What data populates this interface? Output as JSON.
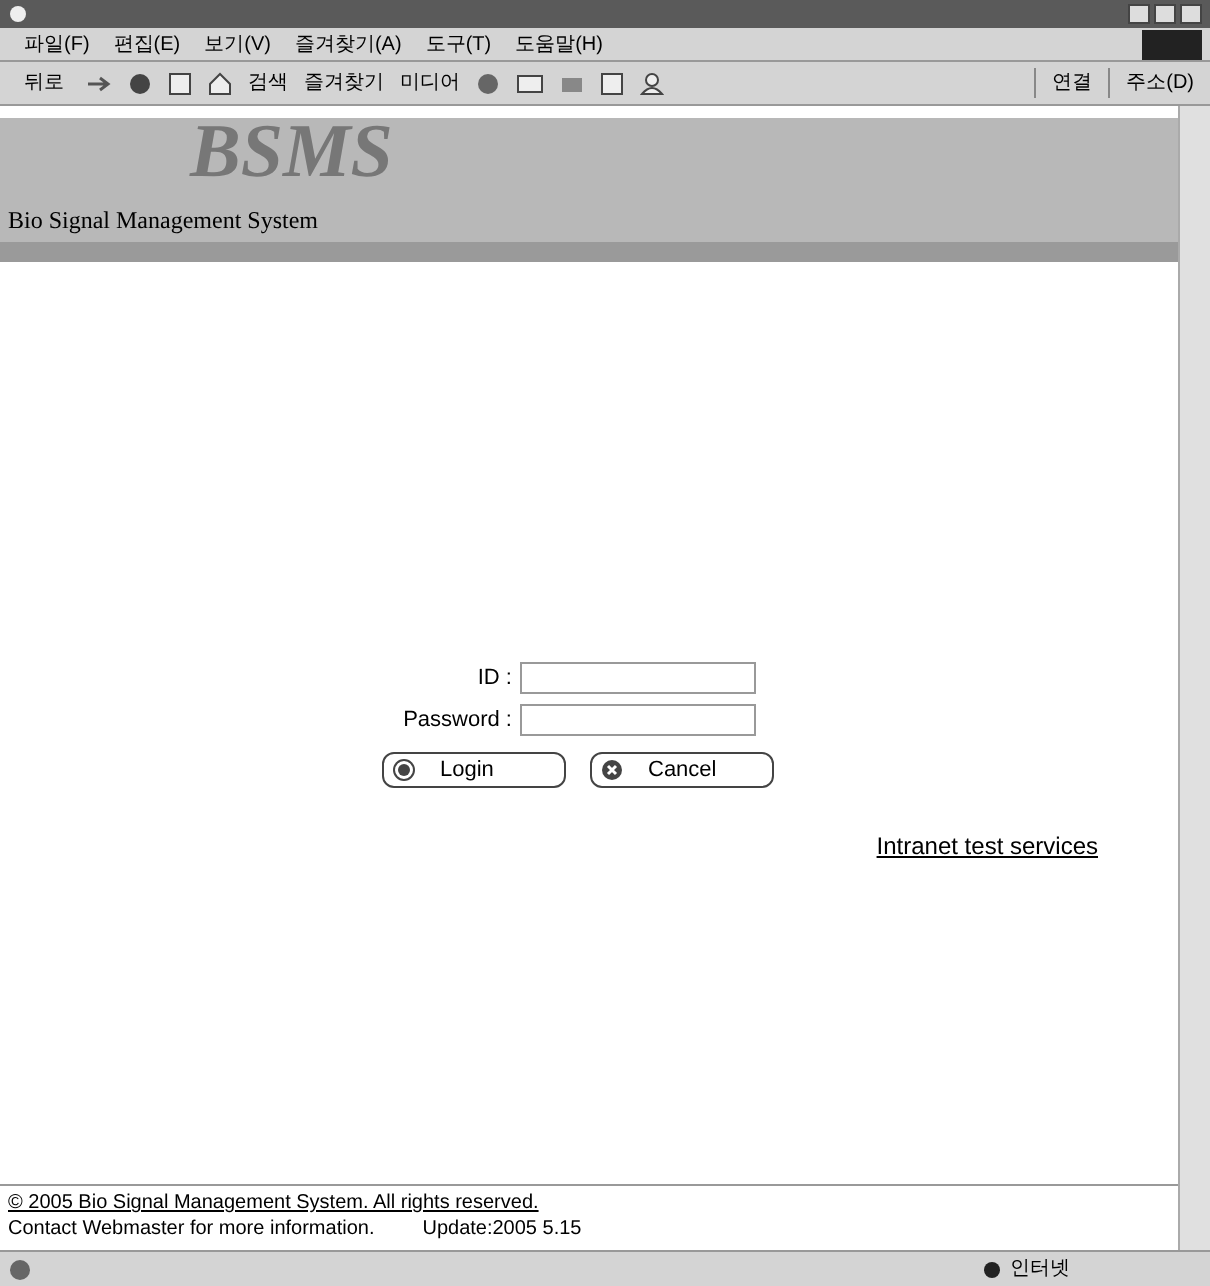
{
  "menu_bar": {
    "items": [
      "파일(F)",
      "편집(E)",
      "보기(V)",
      "즐겨찾기(A)",
      "도구(T)",
      "도움말(H)"
    ]
  },
  "toolbar": {
    "back": "뒤로",
    "search": "검색",
    "favorites": "즐겨찾기",
    "media": "미디어",
    "links": "연결",
    "address": "주소(D)"
  },
  "header": {
    "logo": "BSMS",
    "subtitle": "Bio Signal Management System"
  },
  "login": {
    "id_label": "ID :",
    "password_label": "Password :",
    "buttons": [
      {
        "label": "Login",
        "kind": "login"
      },
      {
        "label": "Cancel",
        "kind": "cancel"
      }
    ]
  },
  "intranet_link": "Intranet test services",
  "footer": {
    "copyright": "© 2005 Bio Signal Management System. All rights reserved.",
    "contact": "Contact Webmaster for more information.",
    "update": "Update:2005  5.15"
  },
  "status_bar": {
    "zone": "인터넷"
  }
}
